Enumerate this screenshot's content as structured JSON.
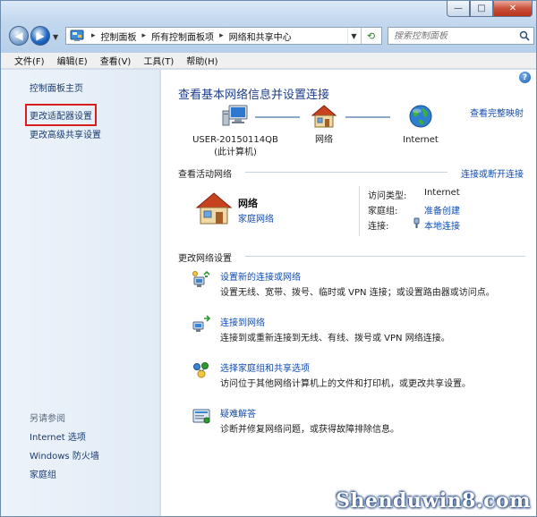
{
  "window": {
    "caption_buttons": {
      "minimize": "—",
      "maximize": "□",
      "close": "✕"
    }
  },
  "navigation": {
    "breadcrumbs": [
      "控制面板",
      "所有控制面板项",
      "网络和共享中心"
    ],
    "search_placeholder": "搜索控制面板"
  },
  "menubar": {
    "items": [
      "文件(F)",
      "编辑(E)",
      "查看(V)",
      "工具(T)",
      "帮助(H)"
    ]
  },
  "sidebar": {
    "links": [
      "控制面板主页",
      "更改适配器设置",
      "更改高级共享设置"
    ],
    "see_also_label": "另请参阅",
    "see_also": [
      "Internet 选项",
      "Windows 防火墙",
      "家庭组"
    ]
  },
  "main": {
    "title": "查看基本网络信息并设置连接",
    "view_full_map": "查看完整映射",
    "network_map": {
      "computer_line1": "USER-20150114QB",
      "computer_line2": "(此计算机)",
      "network_label": "网络",
      "internet_label": "Internet"
    },
    "active_networks": {
      "heading": "查看活动网络",
      "connect_disconnect": "连接或断开连接",
      "network_name": "网络",
      "network_type": "家庭网络",
      "access_type_label": "访问类型:",
      "access_type_value": "Internet",
      "homegroup_label": "家庭组:",
      "homegroup_value": "准备创建",
      "connections_label": "连接:",
      "connections_value": "本地连接"
    },
    "change_settings": {
      "heading": "更改网络设置",
      "tasks": [
        {
          "title": "设置新的连接或网络",
          "desc": "设置无线、宽带、拨号、临时或 VPN 连接；或设置路由器或访问点。"
        },
        {
          "title": "连接到网络",
          "desc": "连接到或重新连接到无线、有线、拨号或 VPN 网络连接。"
        },
        {
          "title": "选择家庭组和共享选项",
          "desc": "访问位于其他网络计算机上的文件和打印机，或更改共享设置。"
        },
        {
          "title": "疑难解答",
          "desc": "诊断并修复网络问题，或获得故障排除信息。"
        }
      ]
    }
  },
  "watermark": "Shenduwin8.com",
  "colors": {
    "link": "#0f4bb0",
    "title": "#1e3f8a",
    "highlight_box": "#d81e1e"
  }
}
